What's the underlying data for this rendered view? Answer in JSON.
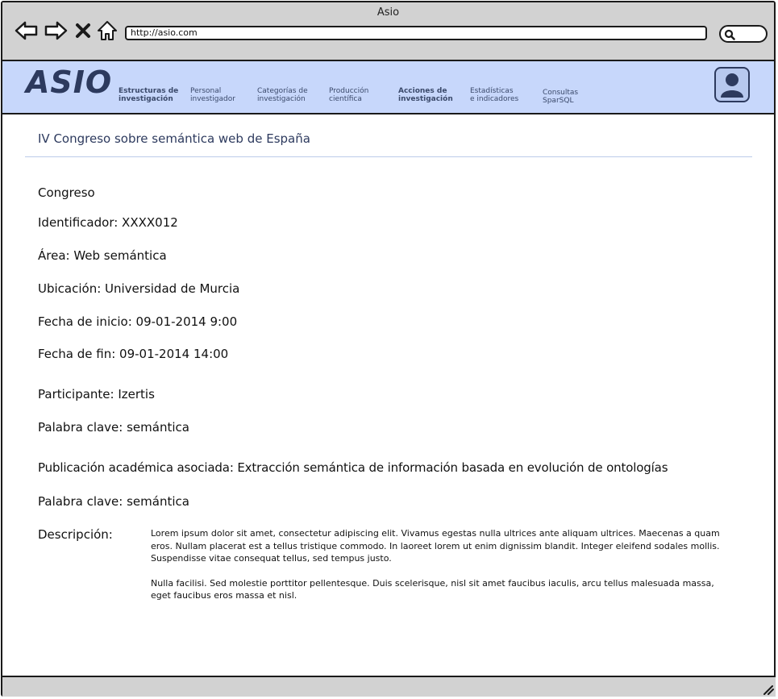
{
  "window": {
    "title": "Asio"
  },
  "browser": {
    "url": "http://asio.com"
  },
  "header": {
    "logo": "ASIO",
    "menu": [
      {
        "line1": "Estructuras de",
        "line2": "investigación"
      },
      {
        "line1": "Personal",
        "line2": "investigador"
      },
      {
        "line1": "Categorías de",
        "line2": "investigación"
      },
      {
        "line1": "Producción",
        "line2": "científica"
      },
      {
        "line1": "Acciones de",
        "line2": "investigación"
      },
      {
        "line1": "Estadísticas",
        "line2": "e indicadores"
      },
      {
        "line1": "Consultas",
        "line2": "SparSQL"
      }
    ]
  },
  "main": {
    "title": "IV Congreso sobre semántica web de España",
    "fields": {
      "type": "Congreso",
      "identificador": "Identificador: XXXX012",
      "area": "Área: Web semántica",
      "ubicacion": "Ubicación: Universidad de Murcia",
      "fecha_inicio": "Fecha de inicio: 09-01-2014 9:00",
      "fecha_fin": "Fecha de fin: 09-01-2014 14:00",
      "participante": "Participante: Izertis",
      "palabra_clave_1": "Palabra clave: semántica",
      "publicacion": "Publicación académica asociada: Extracción semántica de información basada en evolución de ontologías",
      "palabra_clave_2": "Palabra clave: semántica"
    },
    "description": {
      "label": "Descripción:",
      "paragraph1": "Lorem ipsum dolor sit amet, consectetur adipiscing elit. Vivamus egestas nulla ultrices ante aliquam ultrices. Maecenas a quam eros. Nullam placerat est a tellus tristique commodo. In laoreet lorem ut enim dignissim blandit. Integer eleifend sodales mollis. Suspendisse vitae consequat tellus, sed tempus justo.",
      "paragraph2": "Nulla facilisi. Sed molestie porttitor pellentesque. Duis scelerisque, nisl sit amet faucibus iaculis, arcu tellus malesuada massa, eget faucibus eros massa et nisl."
    }
  },
  "icons": {
    "back": "arrow-left-icon",
    "forward": "arrow-right-icon",
    "stop": "close-icon",
    "home": "home-icon",
    "search": "search-icon",
    "user": "user-avatar-icon",
    "resize": "resize-grip-icon"
  },
  "colors": {
    "header_bg": "#c7d7fb",
    "chrome_bg": "#d2d2d2",
    "brand": "#2d3a5e",
    "divider": "#bccbe9"
  }
}
